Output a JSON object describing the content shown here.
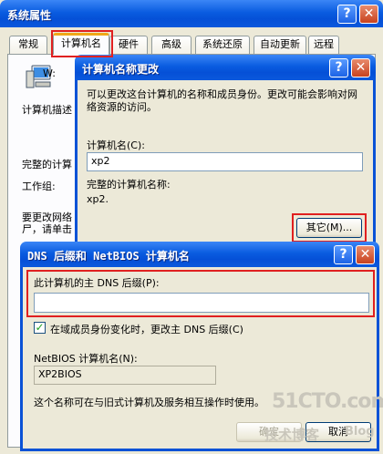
{
  "sysprops": {
    "title": "系统属性",
    "tabs": [
      "常规",
      "计算机名",
      "硬件",
      "高级",
      "系统还原",
      "自动更新",
      "远程"
    ],
    "line_partial_1": "W:",
    "line_partial_2": "计算机描述",
    "line_partial_3": "完整的计算",
    "line_partial_4": "工作组:",
    "line_partial_5": "要更改网络",
    "line_partial_6": "尸，请单击"
  },
  "cnchange": {
    "title": "计算机名称更改",
    "intro": "可以更改这台计算机的名称和成员身份。更改可能会影响对网络资源的访问。",
    "computer_name_label": "计算机名(C):",
    "computer_name_value": "xp2",
    "full_name_label": "完整的计算机名称:",
    "full_name_value": "xp2.",
    "other_button": "其它(M)..."
  },
  "dns": {
    "title": "DNS 后缀和 NetBIOS 计算机名",
    "primary_suffix_label": "此计算机的主 DNS 后缀(P):",
    "primary_suffix_value": "",
    "change_checkbox_label": "在域成员身份变化时，更改主 DNS 后缀(C)",
    "change_checkbox_checked": true,
    "netbios_label": "NetBIOS 计算机名(N):",
    "netbios_value": "XP2BIOS",
    "note": "这个名称可在与旧式计算机及服务相互操作时使用。",
    "ok_button": "确定",
    "cancel_button": "取消"
  },
  "watermark": {
    "line1": "51CTO.com",
    "line2": "技术博客",
    "line3": "Blog"
  },
  "colors": {
    "titlebar": "#0a5ce0",
    "highlight": "#e02020",
    "window_bg": "#ece9d8"
  }
}
